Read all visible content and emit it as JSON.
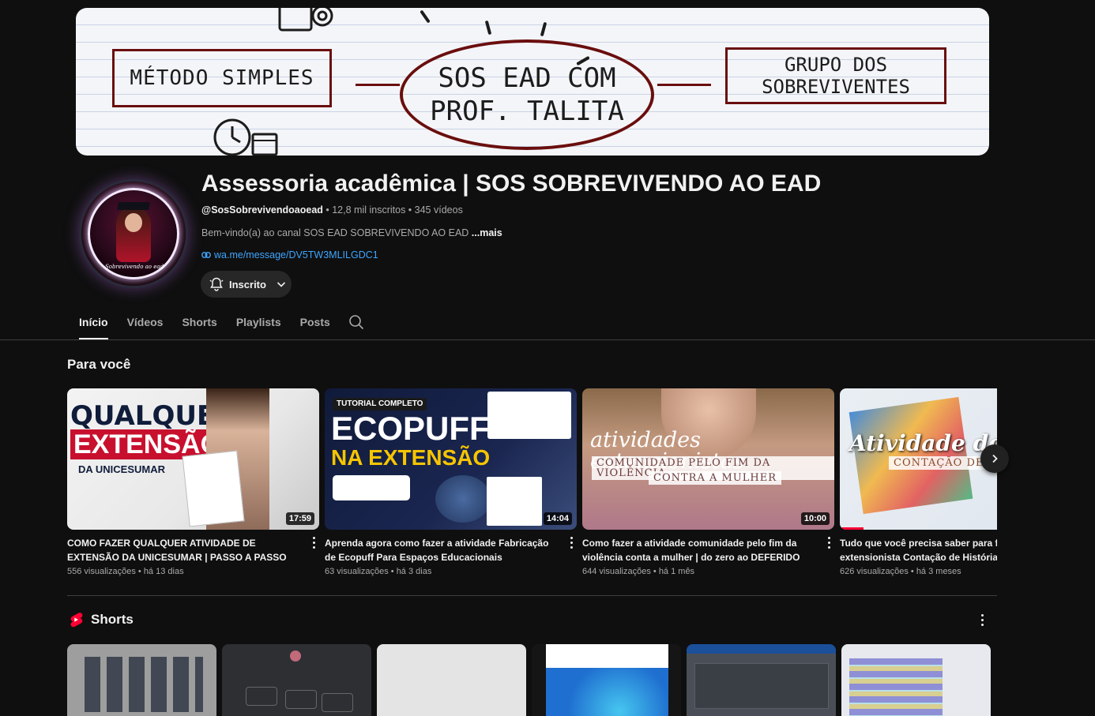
{
  "banner": {
    "left_box": "MÉTODO SIMPLES",
    "center_line1": "SOS EAD COM",
    "center_line2": "PROF. TALITA",
    "right_line1": "GRUPO DOS",
    "right_line2": "SOBREVIVENTES"
  },
  "channel": {
    "name": "Assessoria acadêmica | SOS SOBREVIVENDO AO EAD",
    "handle": "@SosSobrevivendoaoead",
    "subscribers": "12,8 mil inscritos",
    "videos": "345 vídeos",
    "separator": " • ",
    "description": "Bem-vindo(a) ao canal SOS EAD SOBREVIVENDO AO EAD ",
    "more": "...mais",
    "link": "wa.me/message/DV5TW3MLILGDC1",
    "subscribe_label": "Inscrito",
    "avatar_signature": "Sobrevivendo ao ead"
  },
  "tabs": [
    "Início",
    "Vídeos",
    "Shorts",
    "Playlists",
    "Posts"
  ],
  "for_you": {
    "title": "Para você",
    "videos": [
      {
        "title": "COMO FAZER QUALQUER ATIVIDADE DE EXTENSÃO DA UNICESUMAR | PASSO A PASSO COMPLETO ...",
        "views": "556 visualizações",
        "age": "há 13 dias",
        "duration": "17:59",
        "thumb_text1": "QUALQUER",
        "thumb_text2": "EXTENSÃO",
        "thumb_text3": "DA UNICESUMAR"
      },
      {
        "title": "Aprenda agora como fazer a atividade Fabricação de Ecopuff Para Espaços Educacionais",
        "views": "63 visualizações",
        "age": "há 3 dias",
        "duration": "14:04",
        "thumb_text1": "TUTORIAL COMPLETO",
        "thumb_text2": "ECOPUFF",
        "thumb_text3": "NA EXTENSÃO"
      },
      {
        "title": "Como fazer a atividade comunidade pelo fim da violência conta a mulher | do zero ao DEFERIDO",
        "views": "644 visualizações",
        "age": "há 1 mês",
        "duration": "10:00",
        "thumb_text1": "atividades extensionistas",
        "thumb_text2": "COMUNIDADE PELO FIM DA VIOLÊNCIA",
        "thumb_text3": "CONTRA A MULHER"
      },
      {
        "title": "Tudo que você precisa saber para fazer a atividade extensionista Contação de Histórias",
        "views": "626 visualizações",
        "age": "há 3 meses",
        "duration": "",
        "thumb_text1": "Atividade de",
        "thumb_text2": "CONTAÇÃO DE",
        "thumb_text3": ""
      }
    ]
  },
  "shorts": {
    "title": "Shorts"
  },
  "colors": {
    "background": "#0f0f0f",
    "text": "#f1f1f1",
    "muted": "#aaaaaa",
    "link": "#3ea6ff",
    "accent_red": "#ff0033"
  }
}
